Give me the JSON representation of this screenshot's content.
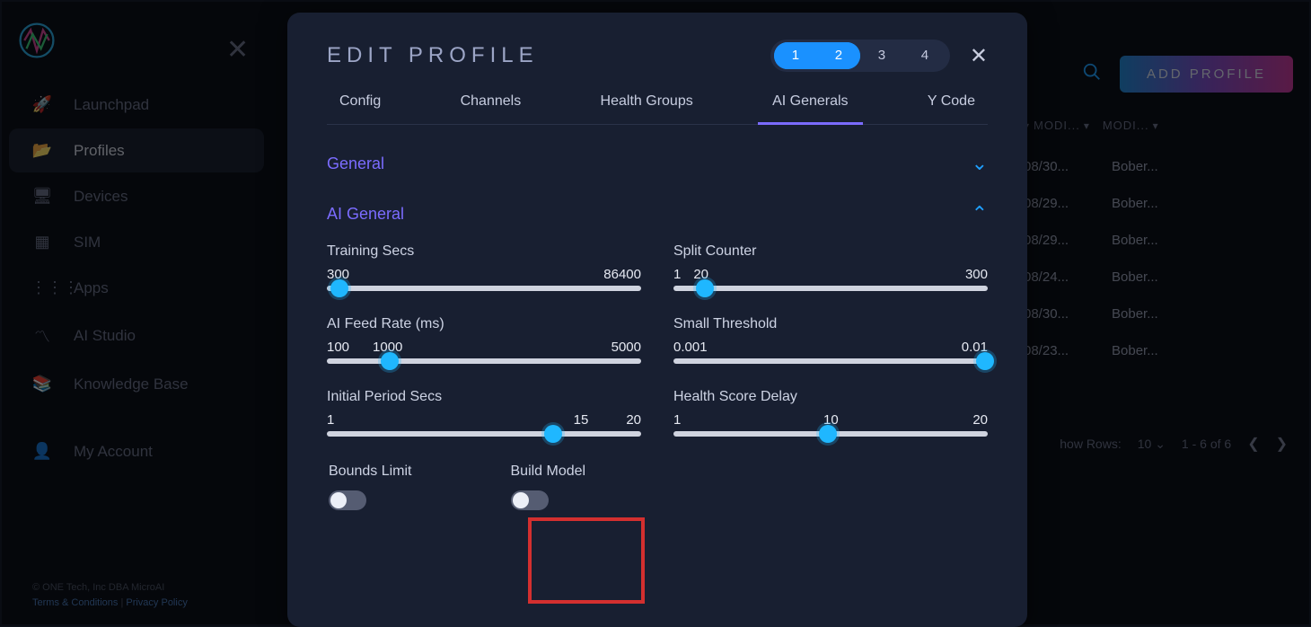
{
  "sidebar": {
    "items": [
      {
        "label": "Launchpad",
        "icon": "rocket",
        "active": false
      },
      {
        "label": "Profiles",
        "icon": "folder",
        "active": true
      },
      {
        "label": "Devices",
        "icon": "monitor",
        "active": false
      },
      {
        "label": "SIM",
        "icon": "sim",
        "active": false
      },
      {
        "label": "Apps",
        "icon": "grid",
        "active": false
      },
      {
        "label": "AI Studio",
        "icon": "pulse",
        "active": false
      },
      {
        "label": "Knowledge Base",
        "icon": "books",
        "active": false
      },
      {
        "label": "My Account",
        "icon": "user",
        "active": false
      }
    ],
    "footer_copyright": "© ONE Tech, Inc DBA MicroAI",
    "footer_terms": "Terms & Conditions",
    "footer_privacy": "Privacy Policy"
  },
  "header": {
    "add_profile_label": "ADD PROFILE"
  },
  "bg_table": {
    "cols": [
      "MODI...",
      "MODI..."
    ],
    "rows": [
      {
        "c1": "08/30...",
        "c2": "Bober..."
      },
      {
        "c1": "08/29...",
        "c2": "Bober..."
      },
      {
        "c1": "08/29...",
        "c2": "Bober..."
      },
      {
        "c1": "08/24...",
        "c2": "Bober..."
      },
      {
        "c1": "08/30...",
        "c2": "Bober..."
      },
      {
        "c1": "08/23...",
        "c2": "Bober..."
      }
    ],
    "pager_label": "how Rows:",
    "pager_size": "10",
    "pager_range": "1 - 6 of 6"
  },
  "modal": {
    "title": "EDIT PROFILE",
    "steps": [
      "1",
      "2",
      "3",
      "4"
    ],
    "active_steps": 2,
    "tabs": [
      "Config",
      "Channels",
      "Health Groups",
      "AI Generals",
      "Y Code"
    ],
    "active_tab": 3,
    "sections": {
      "general_label": "General",
      "ai_general_label": "AI General"
    },
    "sliders": {
      "training_secs": {
        "label": "Training Secs",
        "min": "300",
        "max": "86400",
        "cur": "",
        "pos": 4
      },
      "split_counter": {
        "label": "Split Counter",
        "min": "1",
        "max": "300",
        "cur": "20",
        "pos": 10
      },
      "ai_feed_rate": {
        "label": "AI Feed Rate (ms)",
        "min": "100",
        "max": "5000",
        "cur": "1000",
        "pos": 20
      },
      "small_threshold": {
        "label": "Small Threshold",
        "min": "0.001",
        "max": "0.01",
        "cur": "",
        "pos": 99
      },
      "initial_period": {
        "label": "Initial Period Secs",
        "min": "1",
        "max": "20",
        "cur": "15",
        "pos": 72
      },
      "health_delay": {
        "label": "Health Score Delay",
        "min": "1",
        "max": "20",
        "cur": "10",
        "pos": 49
      }
    },
    "toggles": {
      "bounds_limit": {
        "label": "Bounds Limit",
        "on": false
      },
      "build_model": {
        "label": "Build Model",
        "on": false
      }
    }
  }
}
